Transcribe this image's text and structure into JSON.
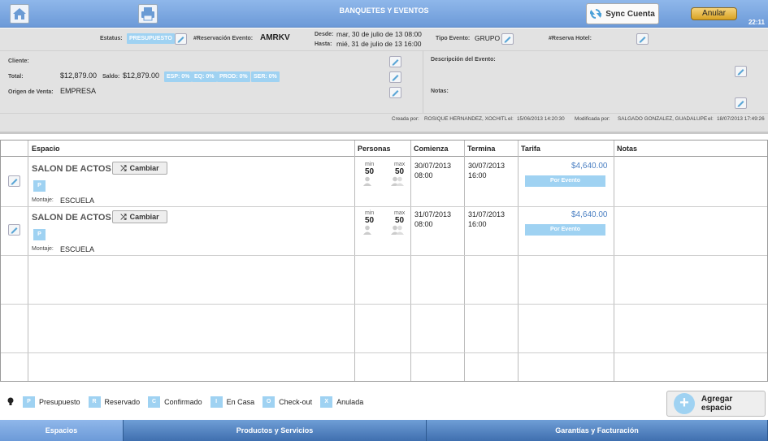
{
  "topbar": {
    "title": "BANQUETES Y EVENTOS",
    "sync_label": "Sync Cuenta",
    "anular_label": "Anular",
    "clock": "22:11",
    "home_icon": "home-icon",
    "print_icon": "printer-icon"
  },
  "event": {
    "estatus_label": "Estatus:",
    "estatus_value": "PRESUPUESTO",
    "reserva_label": "#Reservación Evento:",
    "reserva_value": "AMRKV",
    "desde_label": "Desde:",
    "desde_value": "mar, 30 de julio de 13  08:00",
    "hasta_label": "Hasta:",
    "hasta_value": "mié, 31 de julio de 13  16:00",
    "tipo_label": "Tipo Evento:",
    "tipo_value": "GRUPO",
    "hotel_label": "#Reserva Hotel:",
    "hotel_value": ""
  },
  "details": {
    "cliente_label": "Cliente:",
    "cliente_value": "",
    "total_label": "Total:",
    "total_value": "$12,879.00",
    "saldo_label": "Saldo:",
    "saldo_value": "$12,879.00",
    "pills": [
      "ESP: 0%",
      "EQ: 0%",
      "PROD: 0%",
      "SER: 0%"
    ],
    "origen_label": "Origen de Venta:",
    "origen_value": "EMPRESA",
    "descripcion_label": "Descripción del Evento:",
    "notas_label": "Notas:"
  },
  "audit": {
    "creada_label": "Creada por:",
    "creada_by": "ROSIQUE HERNANDEZ, XOCHITL",
    "el1": "el:",
    "creada_date": "15/06/2013 14:20:30",
    "modificada_label": "Modificada por:",
    "modificada_by": "SALGADO GONZALEZ, GUADALUPE",
    "el2": "el:",
    "modificada_date": "18/07/2013 17:49:26"
  },
  "table": {
    "columns": [
      "Espacio",
      "Personas",
      "Comienza",
      "Termina",
      "Tarifa",
      "Notas"
    ],
    "rows": [
      {
        "espacio": "SALON DE ACTOS",
        "cambiar": "Cambiar",
        "tag": "P",
        "montaje_label": "Montaje:",
        "montaje": "ESCUELA",
        "min_label": "min",
        "min": "50",
        "max_label": "max",
        "max": "50",
        "comienza_date": "30/07/2013",
        "comienza_time": "08:00",
        "termina_date": "30/07/2013",
        "termina_time": "16:00",
        "tarifa": "$4,640.00",
        "tarifa_tipo": "Por Evento",
        "notas": ""
      },
      {
        "espacio": "SALON DE ACTOS",
        "cambiar": "Cambiar",
        "tag": "P",
        "montaje_label": "Montaje:",
        "montaje": "ESCUELA",
        "min_label": "min",
        "min": "50",
        "max_label": "max",
        "max": "50",
        "comienza_date": "31/07/2013",
        "comienza_time": "08:00",
        "termina_date": "31/07/2013",
        "termina_time": "16:00",
        "tarifa": "$4,640.00",
        "tarifa_tipo": "Por Evento",
        "notas": ""
      }
    ]
  },
  "legend": [
    {
      "tag": "P",
      "label": "Presupuesto"
    },
    {
      "tag": "R",
      "label": "Reservado"
    },
    {
      "tag": "C",
      "label": "Confirmado"
    },
    {
      "tag": "I",
      "label": "En Casa"
    },
    {
      "tag": "O",
      "label": "Check-out"
    },
    {
      "tag": "X",
      "label": "Anulada"
    }
  ],
  "add_button": "Agregar espacio",
  "tabs": [
    "Espacios",
    "Productos y Servicios",
    "Garantías y Facturación"
  ],
  "colors": {
    "topbar": "#8fb7ea",
    "tag": "#9fd2f2",
    "price": "#4a7fc2",
    "anular": "#e0b040"
  }
}
